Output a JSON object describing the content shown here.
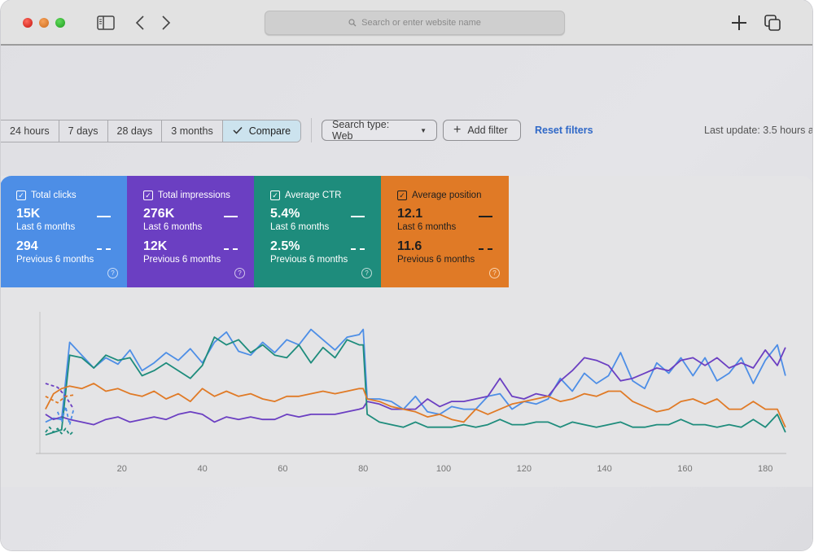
{
  "browser": {
    "url_placeholder": "Search or enter website name",
    "icons": [
      "sidebar-toggle-icon",
      "back-icon",
      "forward-icon",
      "search-icon",
      "new-tab-icon",
      "tabs-overview-icon"
    ]
  },
  "filters": {
    "date_ranges": [
      {
        "label": "24 hours",
        "active": false
      },
      {
        "label": "7 days",
        "active": false
      },
      {
        "label": "28 days",
        "active": false
      },
      {
        "label": "3 months",
        "active": false
      },
      {
        "label": "Compare",
        "active": true
      }
    ],
    "search_type": "Search type: Web",
    "add_filter": "Add filter",
    "reset_filters": "Reset filters",
    "last_update": "Last update: 3.5 hours a"
  },
  "metrics": [
    {
      "name": "Total clicks",
      "checked": true,
      "current_value": "15K",
      "current_label": "Last 6 months",
      "previous_value": "294",
      "previous_label": "Previous 6 months",
      "color": "#4d8ee6"
    },
    {
      "name": "Total impressions",
      "checked": true,
      "current_value": "276K",
      "current_label": "Last 6 months",
      "previous_value": "12K",
      "previous_label": "Previous 6 months",
      "color": "#6b3fc2"
    },
    {
      "name": "Average CTR",
      "checked": true,
      "current_value": "5.4%",
      "current_label": "Last 6 months",
      "previous_value": "2.5%",
      "previous_label": "Previous 6 months",
      "color": "#1e8c7c"
    },
    {
      "name": "Average position",
      "checked": true,
      "current_value": "12.1",
      "current_label": "Last 6 months",
      "previous_value": "11.6",
      "previous_label": "Previous 6 months",
      "color": "#e07a26"
    }
  ],
  "chart_data": {
    "type": "line",
    "title": "",
    "xlabel": "",
    "ylabel": "",
    "x_ticks": [
      "20",
      "40",
      "60",
      "80",
      "100",
      "120",
      "140",
      "160",
      "180"
    ],
    "x_tick_values": [
      20,
      40,
      60,
      80,
      100,
      120,
      140,
      160,
      180
    ],
    "xlim": [
      0,
      186
    ],
    "ylim": [
      0,
      100
    ],
    "y_note": "no y-axis labels; values are relative levels (0 = baseline, 100 = top)",
    "grid": false,
    "legend": "none",
    "x": [
      1,
      3,
      5,
      7,
      10,
      13,
      16,
      19,
      22,
      25,
      28,
      31,
      34,
      37,
      40,
      43,
      46,
      49,
      52,
      55,
      58,
      61,
      64,
      67,
      70,
      73,
      76,
      79,
      80,
      81,
      84,
      87,
      90,
      93,
      96,
      99,
      102,
      105,
      108,
      111,
      114,
      117,
      120,
      123,
      126,
      129,
      132,
      135,
      138,
      141,
      144,
      147,
      150,
      153,
      156,
      159,
      162,
      165,
      168,
      171,
      174,
      177,
      180,
      183,
      185
    ],
    "series": [
      {
        "name": "Total clicks",
        "color": "#4d8ee6",
        "style": "solid",
        "values": [
          20,
          23,
          22,
          82,
          72,
          62,
          70,
          65,
          76,
          60,
          66,
          74,
          68,
          77,
          66,
          82,
          90,
          75,
          72,
          82,
          74,
          84,
          80,
          92,
          84,
          76,
          86,
          88,
          92,
          38,
          38,
          36,
          30,
          40,
          28,
          26,
          32,
          30,
          30,
          40,
          42,
          30,
          36,
          34,
          38,
          54,
          44,
          58,
          50,
          56,
          74,
          52,
          46,
          66,
          58,
          70,
          56,
          70,
          52,
          58,
          70,
          50,
          68,
          80,
          56
        ]
      },
      {
        "name": "Total impressions",
        "color": "#6b3fc2",
        "style": "solid",
        "values": [
          26,
          22,
          24,
          22,
          20,
          18,
          22,
          24,
          20,
          22,
          24,
          22,
          26,
          28,
          26,
          20,
          24,
          22,
          24,
          22,
          22,
          26,
          24,
          26,
          26,
          26,
          28,
          30,
          31,
          36,
          34,
          30,
          30,
          30,
          38,
          32,
          36,
          36,
          38,
          40,
          54,
          40,
          38,
          42,
          40,
          52,
          60,
          70,
          68,
          64,
          52,
          54,
          58,
          62,
          60,
          68,
          70,
          64,
          70,
          62,
          66,
          62,
          76,
          64,
          78
        ]
      },
      {
        "name": "Average CTR",
        "color": "#1e8c7c",
        "style": "solid",
        "values": [
          10,
          12,
          14,
          72,
          70,
          62,
          72,
          68,
          70,
          56,
          60,
          66,
          60,
          54,
          64,
          86,
          80,
          84,
          74,
          80,
          72,
          70,
          80,
          66,
          78,
          70,
          84,
          80,
          80,
          26,
          20,
          18,
          16,
          20,
          16,
          16,
          16,
          18,
          16,
          18,
          22,
          18,
          18,
          20,
          20,
          16,
          20,
          18,
          16,
          18,
          20,
          16,
          16,
          18,
          18,
          22,
          18,
          18,
          16,
          18,
          16,
          22,
          16,
          26,
          12
        ]
      },
      {
        "name": "Average position",
        "color": "#e07a26",
        "style": "solid",
        "values": [
          30,
          42,
          46,
          48,
          46,
          50,
          44,
          46,
          42,
          40,
          44,
          38,
          42,
          36,
          46,
          40,
          44,
          40,
          42,
          38,
          36,
          40,
          40,
          42,
          44,
          42,
          44,
          46,
          46,
          38,
          36,
          32,
          30,
          28,
          24,
          26,
          22,
          20,
          30,
          26,
          30,
          34,
          36,
          38,
          40,
          36,
          38,
          42,
          40,
          44,
          44,
          36,
          32,
          28,
          30,
          36,
          38,
          34,
          38,
          30,
          30,
          36,
          30,
          30,
          16
        ]
      },
      {
        "name": "Total impressions (previous)",
        "color": "#6b3fc2",
        "style": "dashed",
        "x": [
          1,
          4,
          6,
          8
        ],
        "values": [
          50,
          47,
          40,
          30
        ]
      },
      {
        "name": "Total clicks (previous)",
        "color": "#4d8ee6",
        "style": "dashed",
        "x": [
          4,
          5,
          6,
          7,
          8
        ],
        "values": [
          28,
          20,
          32,
          18,
          30
        ]
      },
      {
        "name": "Average CTR (previous)",
        "color": "#1e8c7c",
        "style": "dashed",
        "x": [
          1,
          2,
          3,
          4,
          5,
          6,
          7,
          8
        ],
        "values": [
          12,
          16,
          12,
          15,
          11,
          15,
          10,
          13
        ]
      },
      {
        "name": "Average position (previous)",
        "color": "#e07a26",
        "style": "dashed",
        "x": [
          1,
          4,
          6,
          8
        ],
        "values": [
          40,
          35,
          40,
          41
        ]
      }
    ]
  }
}
